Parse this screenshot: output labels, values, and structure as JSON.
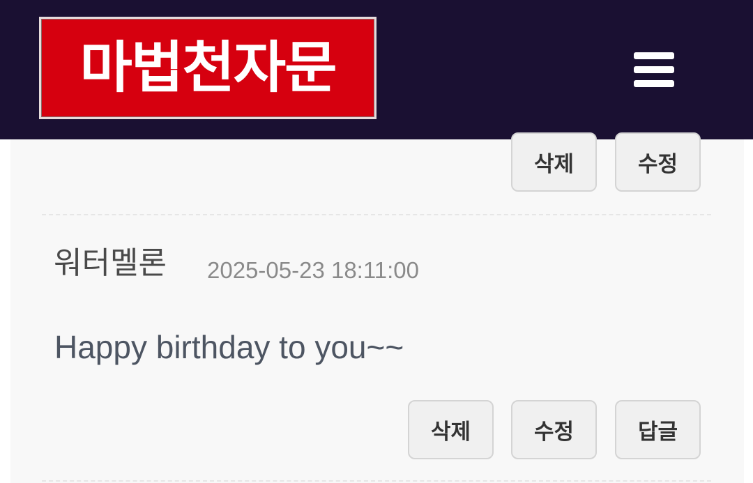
{
  "header": {
    "logo_text": "마법천자문",
    "menu_icon": "hamburger-menu-icon",
    "background_color": "#1a1032",
    "logo_color": "#d6000f"
  },
  "previous_comment": {
    "delete_label": "삭제",
    "edit_label": "수정"
  },
  "comment": {
    "author": "워터멜론",
    "timestamp": "2025-05-23 18:11:00",
    "text": "Happy birthday to you~~",
    "delete_label": "삭제",
    "edit_label": "수정",
    "reply_label": "답글"
  }
}
